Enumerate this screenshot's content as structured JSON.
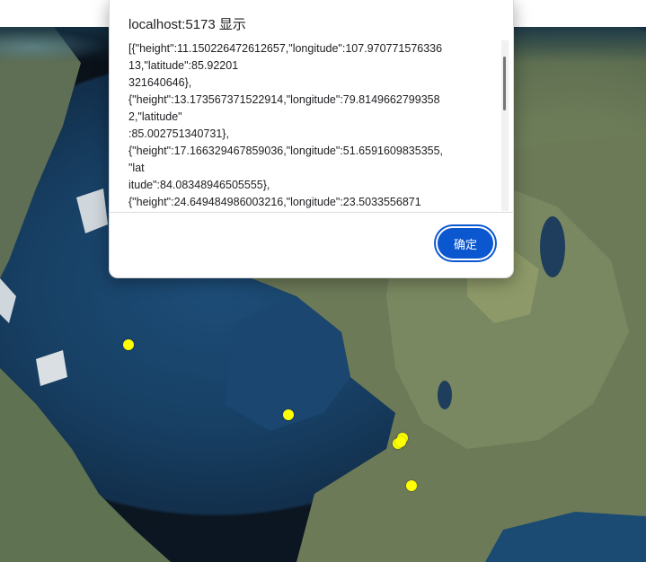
{
  "dialog": {
    "title": "localhost:5173 显示",
    "message_lines": [
      "[{\"height\":11.150226472612657,\"longitude\":107.970771576336",
      "13,\"latitude\":85.92201",
      "321640646},",
      "{\"height\":13.173567371522914,\"longitude\":79.8149662799358",
      "2,\"latitude\"",
      ":85.002751340731},",
      "{\"height\":17.166329467859036,\"longitude\":51.6591609835355,",
      "\"lat",
      "itude\":84.08348946505555},",
      "{\"height\":24.649484986003216,\"longitude\":23.5033556871"
    ],
    "ok_label": "确定"
  },
  "map": {
    "marker_color": "#ffff00",
    "marker_count": 6
  }
}
